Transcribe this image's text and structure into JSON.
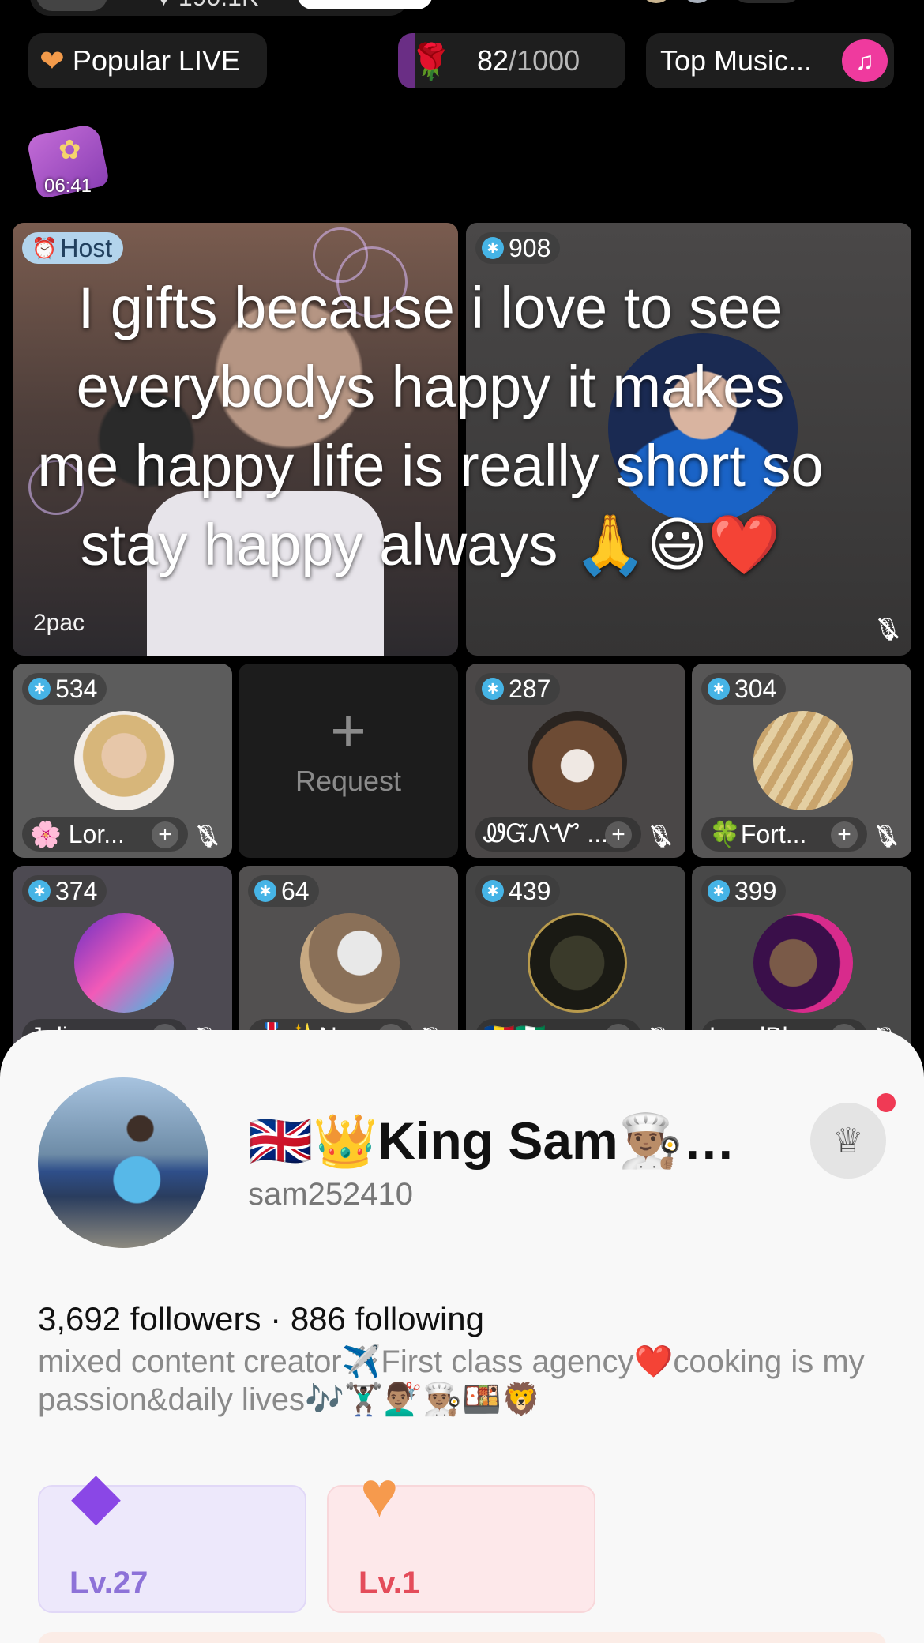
{
  "top_bar": {
    "host_likes": "190.1K",
    "popular_live": "Popular LIVE",
    "rose_goal": {
      "current": "82",
      "target": "/1000"
    },
    "top_music": "Top Music..."
  },
  "gift_timer": "06:41",
  "overlay_message": "I gifts because i love to see everybodys happy it makes me happy life is really short so stay happy always 🙏😃❤️",
  "host_tile": {
    "badge": "Host",
    "name": "2pac"
  },
  "big_guest": {
    "score": "908"
  },
  "guests": [
    {
      "score": "534",
      "name": "🌸 Lor..."
    },
    {
      "score": "287",
      "name": "ᏪᏳᏁᏉ ..."
    },
    {
      "score": "304",
      "name": "🍀Fort..."
    },
    {
      "score": "374",
      "name": "Julie"
    },
    {
      "score": "64",
      "name": "🎖️✨N..."
    },
    {
      "score": "439",
      "name": "🇷🇴🇳🇬"
    },
    {
      "score": "399",
      "name": "LondBl..."
    }
  ],
  "request": {
    "label": "Request"
  },
  "profile": {
    "name": "🇬🇧👑King Sam👨🏽‍🍳…",
    "handle": "sam252410",
    "stats": "3,692 followers · 886 following",
    "bio": "mixed content creator✈️First class agency❤️cooking is my passion&daily lives🎶🏋🏿‍♂️💇🏽‍♂️👨🏽‍🍳🍱🦁",
    "gifter_level": "Lv.27",
    "fan_level": "Lv.1"
  },
  "icons": {
    "popular": "orange-heart-icon",
    "rose": "rose-icon",
    "music": "music-note-icon",
    "gift": "gift-box-icon",
    "mic_muted": "mic-off-icon",
    "crown": "crown-icon",
    "gifter": "purple-diamond-icon",
    "fan": "orange-heart-icon"
  },
  "colors": {
    "accent_pink": "#ef3a9e",
    "badge_blue": "#46b4e6",
    "notif_red": "#f03a55",
    "gifter_purple": "#8d72d8",
    "fan_red": "#e44c5a"
  }
}
